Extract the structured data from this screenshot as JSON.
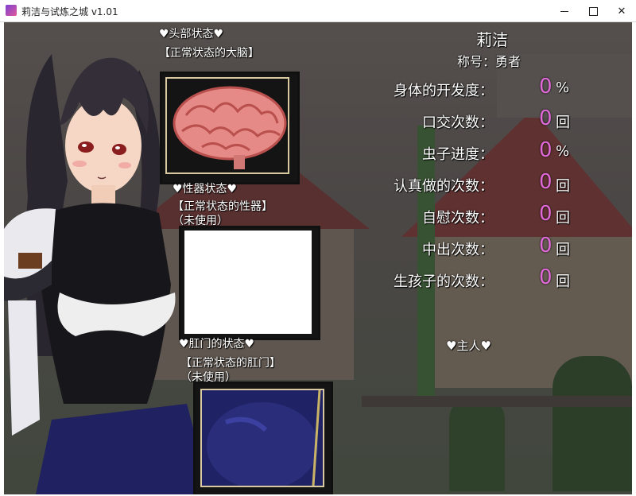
{
  "window": {
    "title": "莉洁与试炼之城 v1.01",
    "controls": {
      "minimize": "minimize-icon",
      "maximize": "maximize-icon",
      "close": "close-icon"
    }
  },
  "status_panel": {
    "head_title": "♥头部状态♥",
    "head_state": "【正常状态的大脑】",
    "genital_title": "♥性器状态♥",
    "genital_state": "【正常状态的性器】",
    "genital_note": "（未使用）",
    "anal_title": "♥肛门的状态♥",
    "anal_state": "【正常状态的肛门】",
    "anal_note": "（未使用）"
  },
  "profile": {
    "name": "莉洁",
    "title_line": "称号：勇者",
    "stats": [
      {
        "label": "身体的开发度：",
        "value": "0",
        "unit": "%"
      },
      {
        "label": "口交次数：",
        "value": "0",
        "unit": "回"
      },
      {
        "label": "虫子进度：",
        "value": "0",
        "unit": "%"
      },
      {
        "label": "认真做的次数：",
        "value": "0",
        "unit": "回"
      },
      {
        "label": "自慰次数：",
        "value": "0",
        "unit": "回"
      },
      {
        "label": "中出次数：",
        "value": "0",
        "unit": "回"
      },
      {
        "label": "生孩子的次数：",
        "value": "0",
        "unit": "回"
      }
    ],
    "master_label": "♥主人♥"
  },
  "colors": {
    "accent_value": "#e06ad8",
    "text": "#ffffff"
  }
}
